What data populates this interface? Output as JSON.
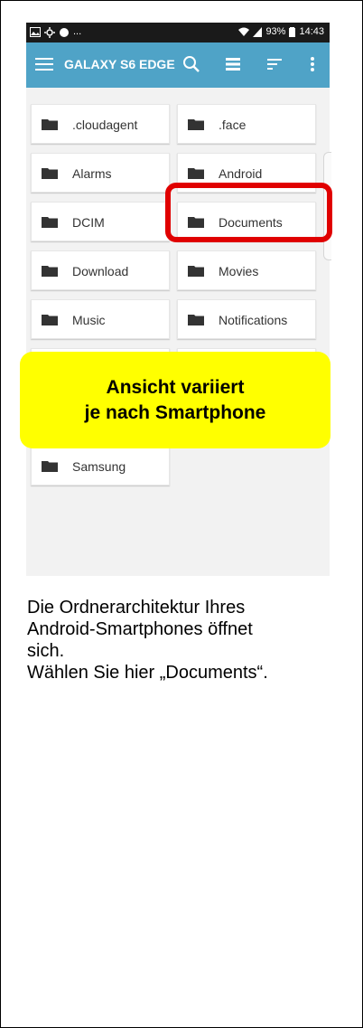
{
  "status_bar": {
    "left_icons": [
      "image-icon",
      "settings-icon",
      "circle-icon",
      "more-dots"
    ],
    "left_dots": "...",
    "battery_percent": "93%",
    "time": "14:43"
  },
  "app_bar": {
    "title": "GALAXY S6 EDGE",
    "color": "#4fa3c7"
  },
  "folders": [
    {
      "label": ".cloudagent"
    },
    {
      "label": ".face"
    },
    {
      "label": "Alarms"
    },
    {
      "label": "Android"
    },
    {
      "label": "DCIM"
    },
    {
      "label": "Documents"
    },
    {
      "label": "Download"
    },
    {
      "label": "Movies"
    },
    {
      "label": "Music"
    },
    {
      "label": "Notifications"
    },
    {
      "label": "Samsung"
    }
  ],
  "note": {
    "line1": "Ansicht variiert",
    "line2": "je nach Smartphone"
  },
  "caption": {
    "line1": "Die Ordnerarchitektur Ihres",
    "line2": "Android-Smartphones öffnet",
    "line3": "sich.",
    "line4": "Wählen Sie hier „Documents“."
  },
  "colors": {
    "highlight": "#e00000",
    "note_bg": "#ffff00"
  }
}
